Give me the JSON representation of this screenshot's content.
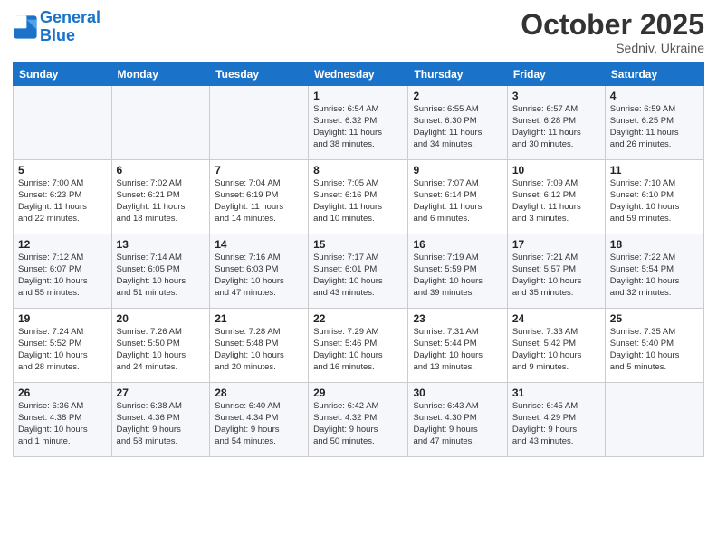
{
  "header": {
    "logo_line1": "General",
    "logo_line2": "Blue",
    "month": "October 2025",
    "location": "Sedniv, Ukraine"
  },
  "weekdays": [
    "Sunday",
    "Monday",
    "Tuesday",
    "Wednesday",
    "Thursday",
    "Friday",
    "Saturday"
  ],
  "weeks": [
    [
      {
        "day": "",
        "info": ""
      },
      {
        "day": "",
        "info": ""
      },
      {
        "day": "",
        "info": ""
      },
      {
        "day": "1",
        "info": "Sunrise: 6:54 AM\nSunset: 6:32 PM\nDaylight: 11 hours\nand 38 minutes."
      },
      {
        "day": "2",
        "info": "Sunrise: 6:55 AM\nSunset: 6:30 PM\nDaylight: 11 hours\nand 34 minutes."
      },
      {
        "day": "3",
        "info": "Sunrise: 6:57 AM\nSunset: 6:28 PM\nDaylight: 11 hours\nand 30 minutes."
      },
      {
        "day": "4",
        "info": "Sunrise: 6:59 AM\nSunset: 6:25 PM\nDaylight: 11 hours\nand 26 minutes."
      }
    ],
    [
      {
        "day": "5",
        "info": "Sunrise: 7:00 AM\nSunset: 6:23 PM\nDaylight: 11 hours\nand 22 minutes."
      },
      {
        "day": "6",
        "info": "Sunrise: 7:02 AM\nSunset: 6:21 PM\nDaylight: 11 hours\nand 18 minutes."
      },
      {
        "day": "7",
        "info": "Sunrise: 7:04 AM\nSunset: 6:19 PM\nDaylight: 11 hours\nand 14 minutes."
      },
      {
        "day": "8",
        "info": "Sunrise: 7:05 AM\nSunset: 6:16 PM\nDaylight: 11 hours\nand 10 minutes."
      },
      {
        "day": "9",
        "info": "Sunrise: 7:07 AM\nSunset: 6:14 PM\nDaylight: 11 hours\nand 6 minutes."
      },
      {
        "day": "10",
        "info": "Sunrise: 7:09 AM\nSunset: 6:12 PM\nDaylight: 11 hours\nand 3 minutes."
      },
      {
        "day": "11",
        "info": "Sunrise: 7:10 AM\nSunset: 6:10 PM\nDaylight: 10 hours\nand 59 minutes."
      }
    ],
    [
      {
        "day": "12",
        "info": "Sunrise: 7:12 AM\nSunset: 6:07 PM\nDaylight: 10 hours\nand 55 minutes."
      },
      {
        "day": "13",
        "info": "Sunrise: 7:14 AM\nSunset: 6:05 PM\nDaylight: 10 hours\nand 51 minutes."
      },
      {
        "day": "14",
        "info": "Sunrise: 7:16 AM\nSunset: 6:03 PM\nDaylight: 10 hours\nand 47 minutes."
      },
      {
        "day": "15",
        "info": "Sunrise: 7:17 AM\nSunset: 6:01 PM\nDaylight: 10 hours\nand 43 minutes."
      },
      {
        "day": "16",
        "info": "Sunrise: 7:19 AM\nSunset: 5:59 PM\nDaylight: 10 hours\nand 39 minutes."
      },
      {
        "day": "17",
        "info": "Sunrise: 7:21 AM\nSunset: 5:57 PM\nDaylight: 10 hours\nand 35 minutes."
      },
      {
        "day": "18",
        "info": "Sunrise: 7:22 AM\nSunset: 5:54 PM\nDaylight: 10 hours\nand 32 minutes."
      }
    ],
    [
      {
        "day": "19",
        "info": "Sunrise: 7:24 AM\nSunset: 5:52 PM\nDaylight: 10 hours\nand 28 minutes."
      },
      {
        "day": "20",
        "info": "Sunrise: 7:26 AM\nSunset: 5:50 PM\nDaylight: 10 hours\nand 24 minutes."
      },
      {
        "day": "21",
        "info": "Sunrise: 7:28 AM\nSunset: 5:48 PM\nDaylight: 10 hours\nand 20 minutes."
      },
      {
        "day": "22",
        "info": "Sunrise: 7:29 AM\nSunset: 5:46 PM\nDaylight: 10 hours\nand 16 minutes."
      },
      {
        "day": "23",
        "info": "Sunrise: 7:31 AM\nSunset: 5:44 PM\nDaylight: 10 hours\nand 13 minutes."
      },
      {
        "day": "24",
        "info": "Sunrise: 7:33 AM\nSunset: 5:42 PM\nDaylight: 10 hours\nand 9 minutes."
      },
      {
        "day": "25",
        "info": "Sunrise: 7:35 AM\nSunset: 5:40 PM\nDaylight: 10 hours\nand 5 minutes."
      }
    ],
    [
      {
        "day": "26",
        "info": "Sunrise: 6:36 AM\nSunset: 4:38 PM\nDaylight: 10 hours\nand 1 minute."
      },
      {
        "day": "27",
        "info": "Sunrise: 6:38 AM\nSunset: 4:36 PM\nDaylight: 9 hours\nand 58 minutes."
      },
      {
        "day": "28",
        "info": "Sunrise: 6:40 AM\nSunset: 4:34 PM\nDaylight: 9 hours\nand 54 minutes."
      },
      {
        "day": "29",
        "info": "Sunrise: 6:42 AM\nSunset: 4:32 PM\nDaylight: 9 hours\nand 50 minutes."
      },
      {
        "day": "30",
        "info": "Sunrise: 6:43 AM\nSunset: 4:30 PM\nDaylight: 9 hours\nand 47 minutes."
      },
      {
        "day": "31",
        "info": "Sunrise: 6:45 AM\nSunset: 4:29 PM\nDaylight: 9 hours\nand 43 minutes."
      },
      {
        "day": "",
        "info": ""
      }
    ]
  ]
}
